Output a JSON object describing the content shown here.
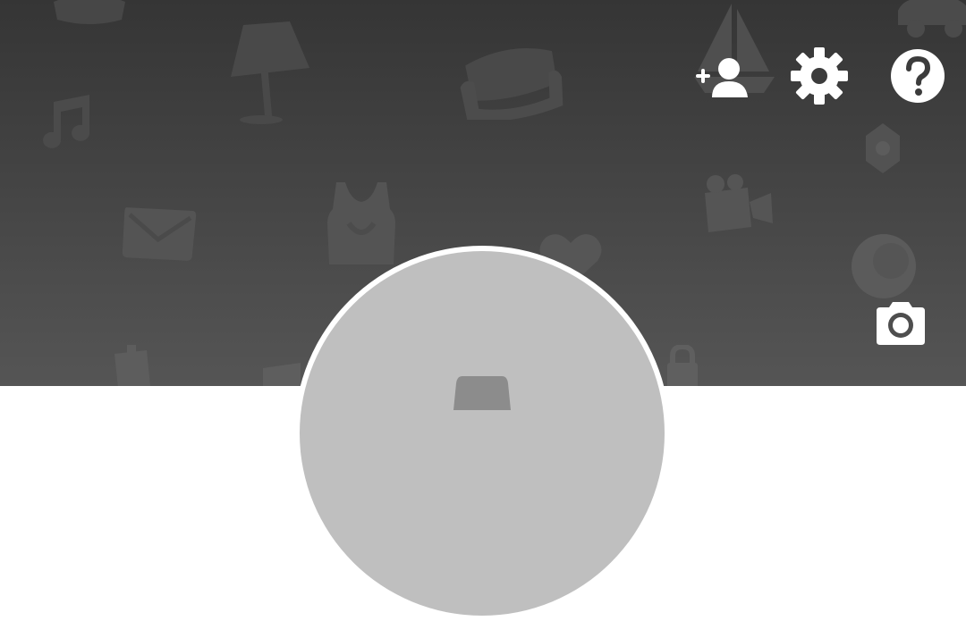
{
  "theme": {
    "background_top": "#353535",
    "background_bottom": "#555555",
    "pattern_color": "#5a5a5a",
    "icon_color": "#ffffff",
    "avatar_ring": "#ffffff",
    "avatar_fill": "#bfbfbf",
    "avatar_silhouette": "#8c8c8c"
  },
  "background_pattern": {
    "icons": [
      "hat-icon",
      "lamp-icon",
      "sofa-icon",
      "sailboat-icon",
      "car-icon",
      "music-note-icon",
      "badge-icon",
      "envelope-icon",
      "tank-top-icon",
      "video-camera-icon",
      "heart-icon",
      "balloon-icon",
      "key-icon",
      "lock-icon"
    ]
  },
  "header": {
    "buttons": [
      {
        "id": "add-friend",
        "icon": "add-person-icon"
      },
      {
        "id": "settings",
        "icon": "gear-icon"
      },
      {
        "id": "help",
        "icon": "question-icon"
      }
    ]
  },
  "profile": {
    "camera_icon": "camera-icon",
    "avatar_icon": "avatar-placeholder-icon"
  }
}
